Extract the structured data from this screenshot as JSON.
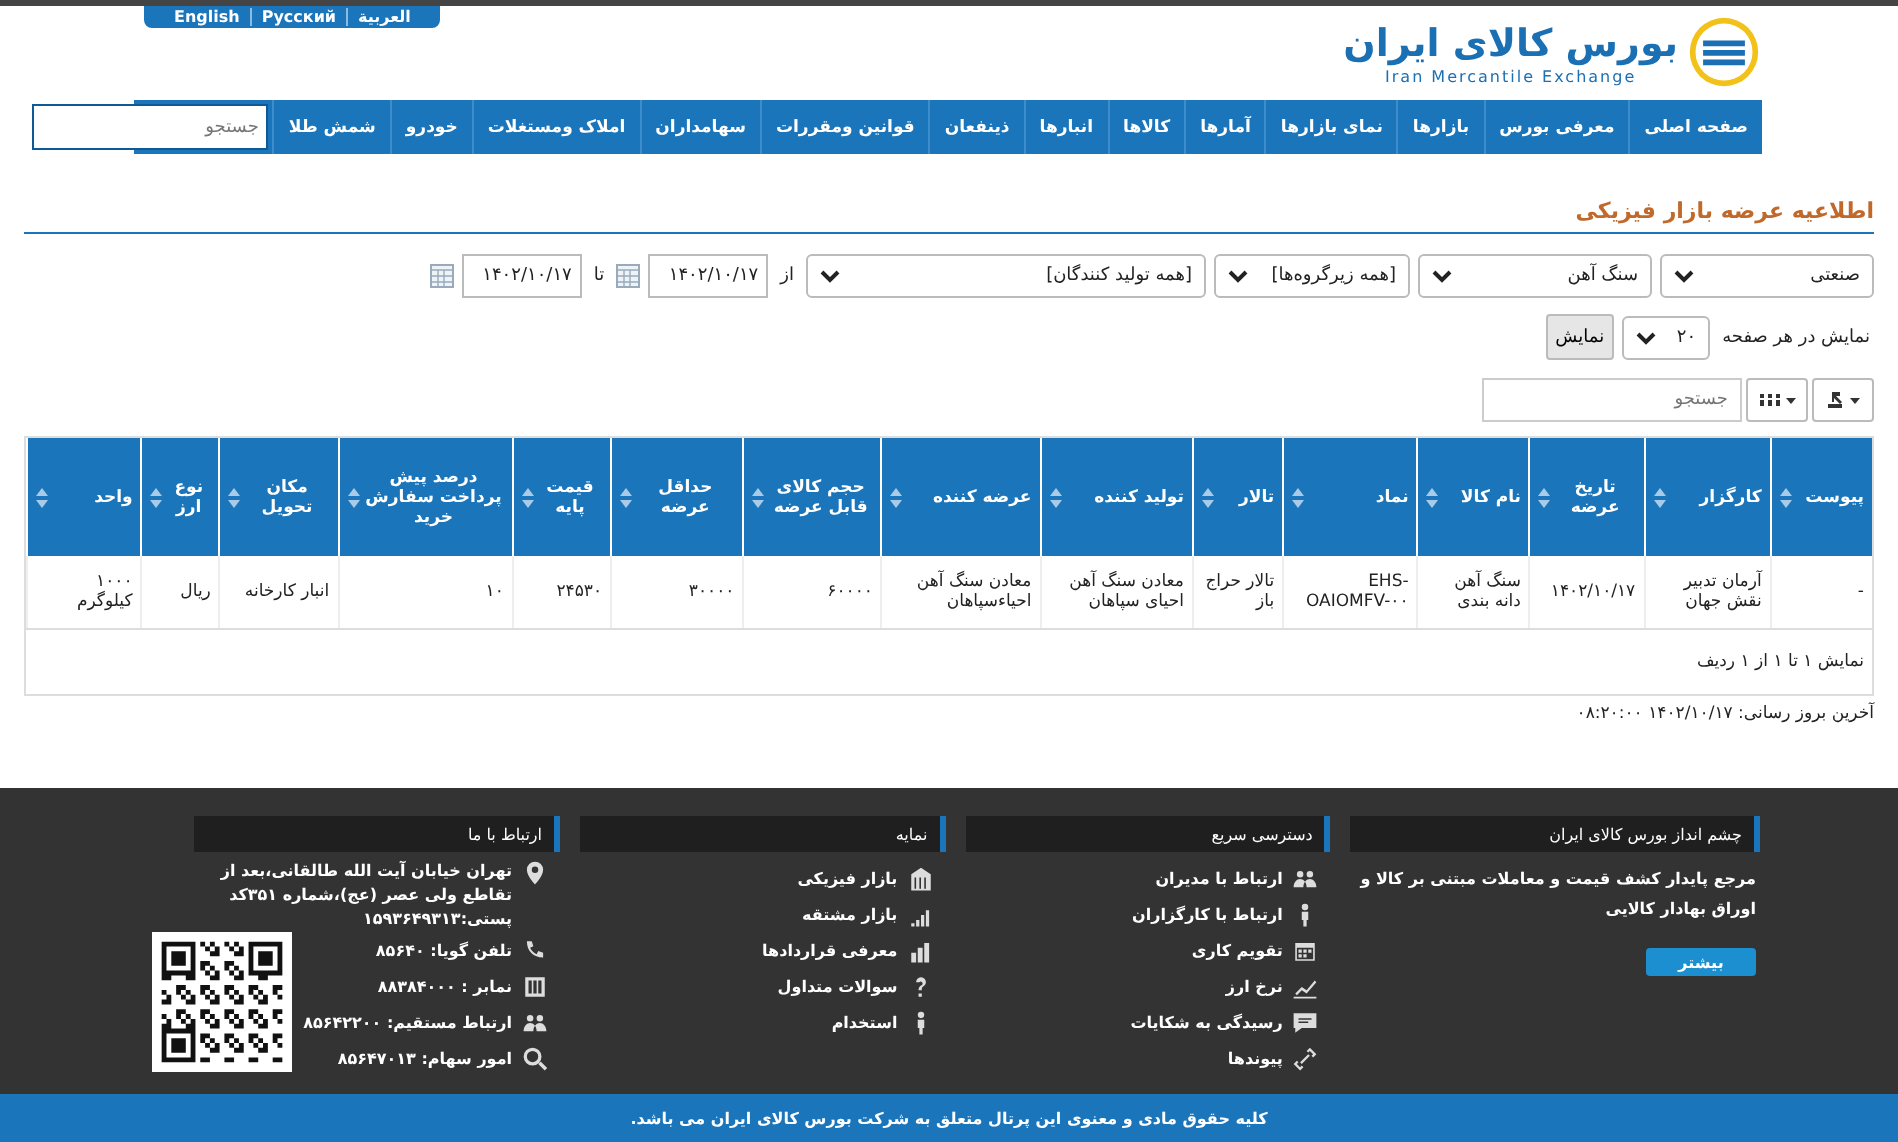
{
  "languages": [
    {
      "label": "العربية"
    },
    {
      "label": "Русский"
    },
    {
      "label": "English"
    }
  ],
  "logo": {
    "title": "بورس کالای ایران",
    "subtitle": "Iran Mercantile Exchange"
  },
  "nav": {
    "items": [
      "صفحه اصلی",
      "معرفی بورس",
      "بازارها",
      "نمای بازارها",
      "آمارها",
      "کالاها",
      "انبارها",
      "ذینفعان",
      "قوانین ومقررات",
      "سهامداران",
      "املاک ومستغلات",
      "خودرو",
      "شمش طلا"
    ],
    "search": {
      "placeholder": "جستجو"
    }
  },
  "page_title": "اطلاعیه عرضه بازار فیزیکی",
  "filters": {
    "selects": [
      "صنعتی",
      "سنگ آهن",
      "[همه زیرگروه‌ها]",
      "[همه تولید کنندگان]"
    ],
    "from_label": "از",
    "from_date": "۱۴۰۲/۱۰/۱۷",
    "to_label": "تا",
    "to_date": "۱۴۰۲/۱۰/۱۷"
  },
  "paging": {
    "label": "نمایش در هر صفحه",
    "page_size": "۲۰",
    "button": "نمایش"
  },
  "table_search": {
    "placeholder": "جستجو"
  },
  "table": {
    "columns": [
      "پیوست",
      "کارگزار",
      "تاریخ عرضه",
      "نام کالا",
      "نماد",
      "تالار",
      "تولید کننده",
      "عرضه کننده",
      "حجم کالای قابل عرضه",
      "حداقل عرضه",
      "قیمت پایه",
      "درصد پیش پرداخت سفارش خرید",
      "مکان تحویل",
      "نوع ارز",
      "واحد"
    ],
    "rows": [
      [
        "-",
        "آرمان تدبیر نقش جهان",
        "۱۴۰۲/۱۰/۱۷",
        "سنگ آهن دانه بندی",
        "EHS-OAIOMFV-۰۰",
        "تالار حراج باز",
        "معادن سنگ آهن احیای سپاهان",
        "معادن سنگ آهن احیاءسپاهان",
        "۶۰۰۰۰",
        "۳۰۰۰۰",
        "۲۴۵۳۰",
        "۱۰",
        "انبار کارخانه",
        "ریال",
        "۱۰۰۰ کیلوگرم"
      ]
    ],
    "info": "نمایش ۱ تا ۱ از ۱ ردیف"
  },
  "last_update": "آخرین بروز رسانی: ۱۴۰۲/۱۰/۱۷ ۰۸:۲۰:۰۰",
  "footer": {
    "vision": {
      "title": "چشم انداز بورس کالای ایران",
      "text": "مرجع پایدار کشف قیمت و معاملات مبتنی بر کالا و اوراق بهادار کالایی",
      "button": "بیشتر"
    },
    "quick": {
      "title": "دسترسی سریع",
      "items": [
        "ارتباط با مدیران",
        "ارتباط با کارگزاران",
        "تقویم کاری",
        "نرخ ارز",
        "رسیدگی به شکایات",
        "پیوندها"
      ]
    },
    "index": {
      "title": "نمایه",
      "items": [
        "بازار فیزیکی",
        "بازار مشتقه",
        "معرفی قراردادها",
        "سوالات متداول",
        "استخدام"
      ]
    },
    "contact": {
      "title": "ارتباط با ما",
      "address": "تهران خیابان آیت الله طالقانی،بعد از تقاطع ولی عصر (عج)،شماره ۳۵۱کد پستی:۱۵۹۳۶۴۹۳۱۳",
      "items": [
        "تلفن گویا: ۸۵۶۴۰",
        "نمابر : ۸۸۳۸۴۰۰۰",
        "ارتباط مستقیم: ۸۵۶۴۲۲۰۰",
        "امور سهام: ۸۵۶۴۷۰۱۳"
      ]
    },
    "copyright": "کلیه حقوق مادی و معنوی این پرتال متعلق به شرکت بورس کالای ایران می باشد."
  }
}
